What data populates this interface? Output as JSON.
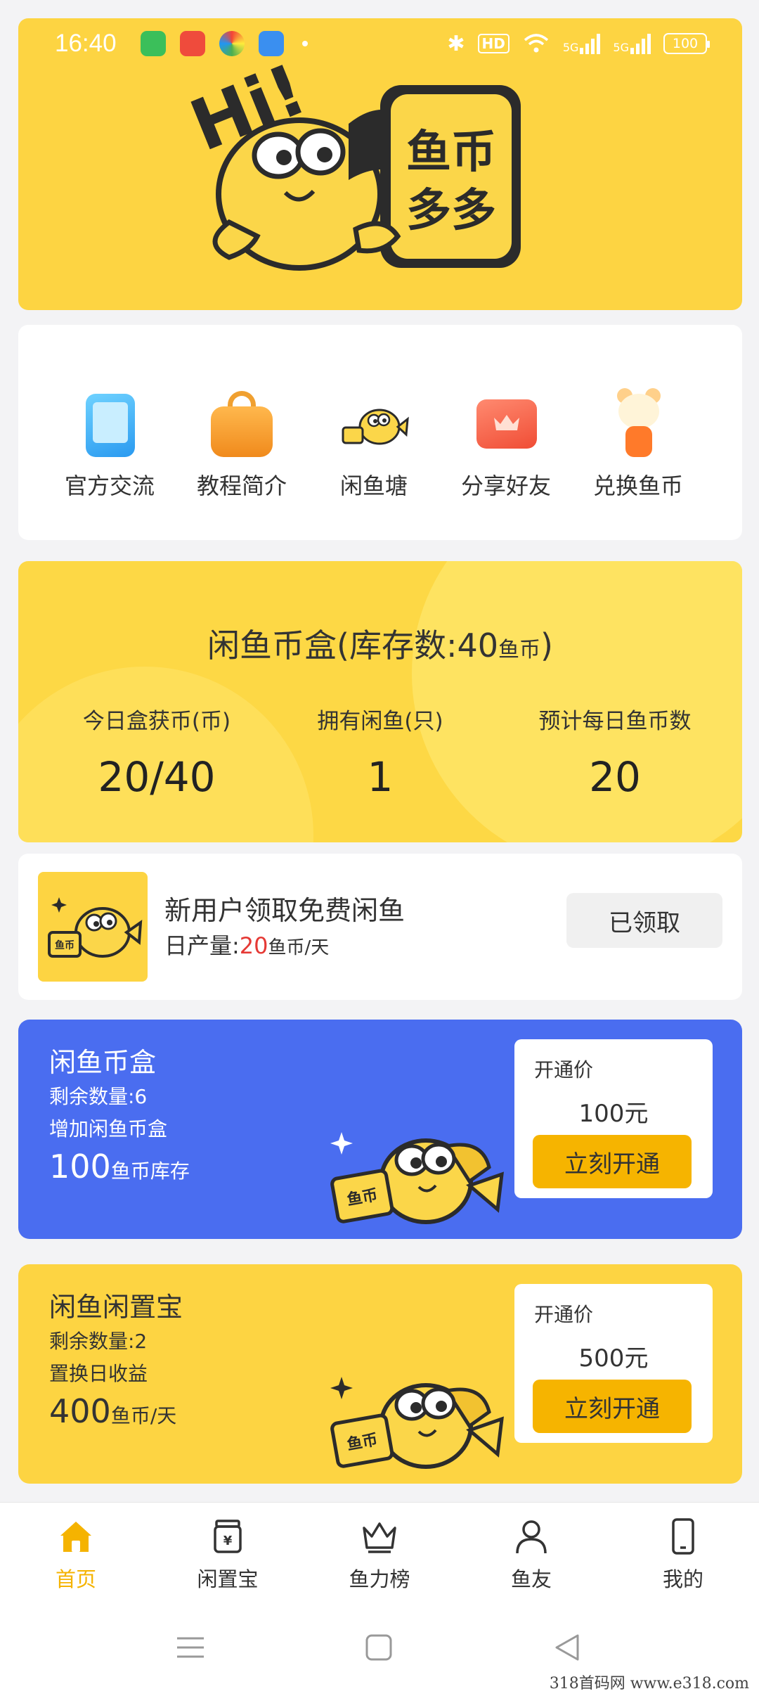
{
  "status_bar": {
    "time": "16:40",
    "bluetooth": "✱",
    "hd": "HD",
    "net1": "5G",
    "net2": "5G",
    "battery": "100"
  },
  "banner": {
    "greeting": "Hi!",
    "logo_text": [
      "鱼币",
      "多多"
    ]
  },
  "quick_menu": [
    {
      "label": "官方交流",
      "icon": "tablet-icon"
    },
    {
      "label": "教程简介",
      "icon": "bag-icon"
    },
    {
      "label": "闲鱼塘",
      "icon": "fish-mascot-icon"
    },
    {
      "label": "分享好友",
      "icon": "share-card-icon"
    },
    {
      "label": "兑换鱼币",
      "icon": "bear-toy-icon"
    }
  ],
  "coin_box": {
    "title_main": "闲鱼币盒(库存数:40",
    "title_unit": "鱼币",
    "title_end": ")",
    "stats": [
      {
        "label": "今日盒获币(币)",
        "value": "20/40"
      },
      {
        "label": "拥有闲鱼(只)",
        "value": "1"
      },
      {
        "label": "预计每日鱼币数",
        "value": "20"
      }
    ]
  },
  "new_user": {
    "title": "新用户领取免费闲鱼",
    "sub_label": "日产量:",
    "sub_value": "20",
    "sub_unit": "鱼币/天",
    "thumb_label": "鱼币",
    "button": "已领取"
  },
  "products": [
    {
      "name": "闲鱼币盒",
      "remain": "剩余数量:6",
      "desc": "增加闲鱼币盒",
      "amount": "100",
      "amount_unit": "鱼币库存",
      "fish_sign": "鱼币",
      "price_label": "开通价",
      "price": "100元",
      "button": "立刻开通"
    },
    {
      "name": "闲鱼闲置宝",
      "remain": "剩余数量:2",
      "desc": "置换日收益",
      "amount": "400",
      "amount_unit": "鱼币/天",
      "fish_sign": "鱼币",
      "price_label": "开通价",
      "price": "500元",
      "button": "立刻开通"
    }
  ],
  "tabbar": [
    {
      "label": "首页",
      "icon": "home-icon",
      "active": true
    },
    {
      "label": "闲置宝",
      "icon": "jar-icon",
      "active": false
    },
    {
      "label": "鱼力榜",
      "icon": "crown-icon",
      "active": false
    },
    {
      "label": "鱼友",
      "icon": "person-icon",
      "active": false
    },
    {
      "label": "我的",
      "icon": "phone-icon",
      "active": false
    }
  ],
  "watermark": "318首码网  www.e318.com",
  "colors": {
    "brand_yellow": "#fdd442",
    "card_blue": "#4a6df0",
    "button_orange": "#f6b400",
    "tab_active": "#f5b300",
    "highlight_red": "#e53935"
  }
}
